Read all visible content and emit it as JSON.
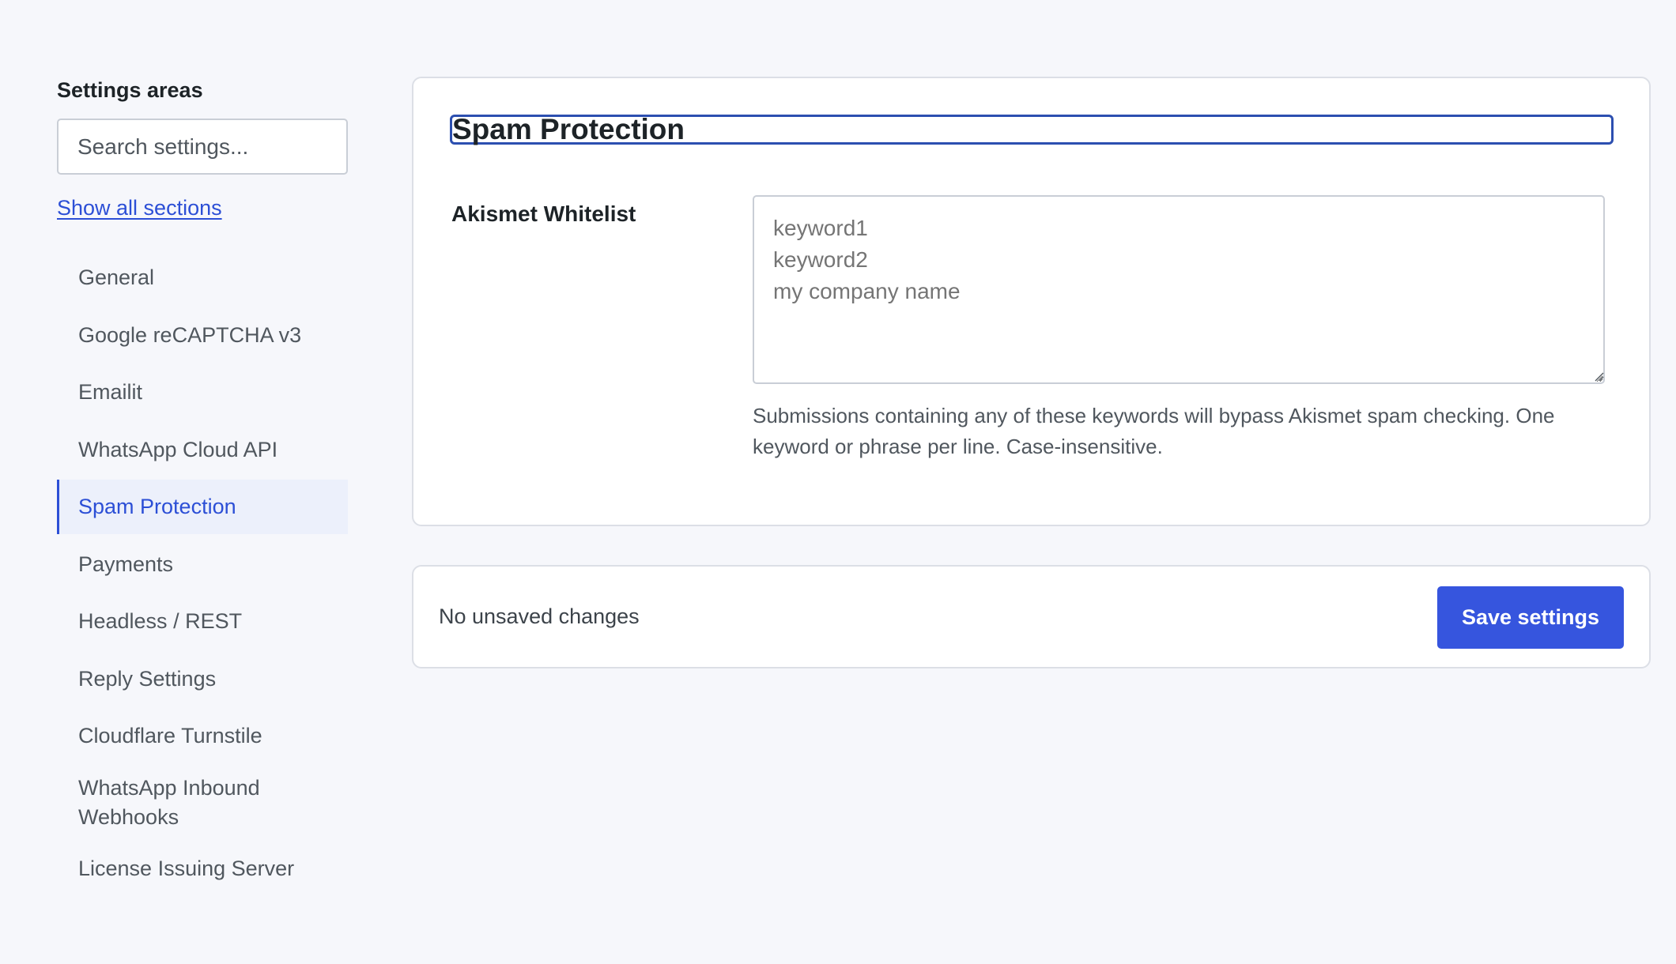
{
  "sidebar": {
    "heading": "Settings areas",
    "search_placeholder": "Search settings...",
    "show_all_label": "Show all sections",
    "items": [
      {
        "label": "General",
        "active": false
      },
      {
        "label": "Google reCAPTCHA v3",
        "active": false
      },
      {
        "label": "Emailit",
        "active": false
      },
      {
        "label": "WhatsApp Cloud API",
        "active": false
      },
      {
        "label": "Spam Protection",
        "active": true
      },
      {
        "label": "Payments",
        "active": false
      },
      {
        "label": "Headless / REST",
        "active": false
      },
      {
        "label": "Reply Settings",
        "active": false
      },
      {
        "label": "Cloudflare Turnstile",
        "active": false
      },
      {
        "label": "WhatsApp Inbound Webhooks",
        "active": false
      },
      {
        "label": "License Issuing Server",
        "active": false
      }
    ]
  },
  "panel": {
    "title": "Spam Protection",
    "field_label": "Akismet Whitelist",
    "textarea_placeholder": "keyword1\nkeyword2\nmy company name",
    "textarea_value": "",
    "help_text": "Submissions containing any of these keywords will bypass Akismet spam checking. One keyword or phrase per line. Case-insensitive."
  },
  "savebar": {
    "status": "No unsaved changes",
    "save_label": "Save settings"
  },
  "colors": {
    "accent": "#3655de",
    "link": "#2c4fd6",
    "active_bg": "#ecf0fb",
    "background": "#f6f7fb"
  }
}
